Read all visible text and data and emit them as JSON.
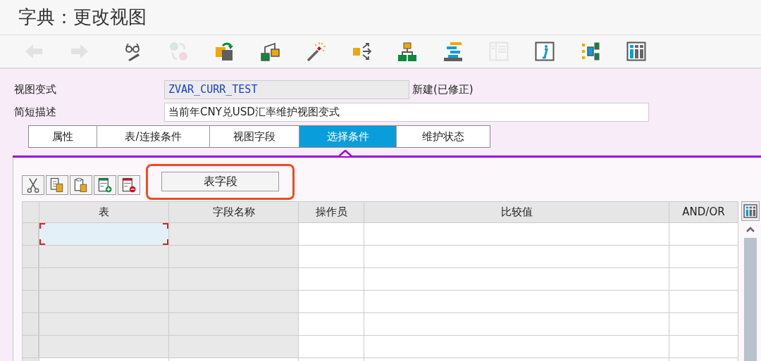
{
  "window": {
    "title": "字典：更改视图"
  },
  "toolbar": [
    {
      "kind": "back",
      "disabled": true
    },
    {
      "kind": "forward",
      "disabled": true
    },
    {
      "kind": "display-change",
      "disabled": false
    },
    {
      "kind": "compare",
      "disabled": true
    },
    {
      "kind": "activate",
      "disabled": false
    },
    {
      "kind": "hierarchy",
      "disabled": false
    },
    {
      "kind": "wizard",
      "disabled": false
    },
    {
      "kind": "where-used",
      "disabled": false
    },
    {
      "kind": "tree",
      "disabled": false
    },
    {
      "kind": "stack",
      "disabled": false
    },
    {
      "kind": "document",
      "disabled": true
    },
    {
      "kind": "info",
      "disabled": false
    },
    {
      "kind": "layout",
      "disabled": false
    },
    {
      "kind": "grid",
      "disabled": false
    }
  ],
  "fields": [
    {
      "label": "视图变式",
      "value": "ZVAR_CURR_TEST",
      "editable": false,
      "status": "新建(已修正)"
    },
    {
      "label": "简短描述",
      "value": "当前年CNY兑USD汇率维护视图变式",
      "editable": true
    }
  ],
  "tabs": [
    {
      "label": "属性",
      "selected": false
    },
    {
      "label": "表/连接条件",
      "selected": false
    },
    {
      "label": "视图字段",
      "selected": false
    },
    {
      "label": "选择条件",
      "selected": true
    },
    {
      "label": "维护状态",
      "selected": false
    }
  ],
  "grid_toolbar": {
    "tools": [
      {
        "kind": "cut"
      },
      {
        "kind": "copy"
      },
      {
        "kind": "paste"
      },
      {
        "kind": "insert-row"
      },
      {
        "kind": "delete-row"
      }
    ],
    "button": "表字段",
    "highlighted": true
  },
  "table": {
    "columns": [
      "表",
      "字段名称",
      "操作员",
      "比较值",
      "AND/OR"
    ],
    "rows": [
      {
        "selected": true
      },
      {
        "selected": false
      },
      {
        "selected": false
      },
      {
        "selected": false
      },
      {
        "selected": false
      },
      {
        "selected": false
      }
    ]
  }
}
